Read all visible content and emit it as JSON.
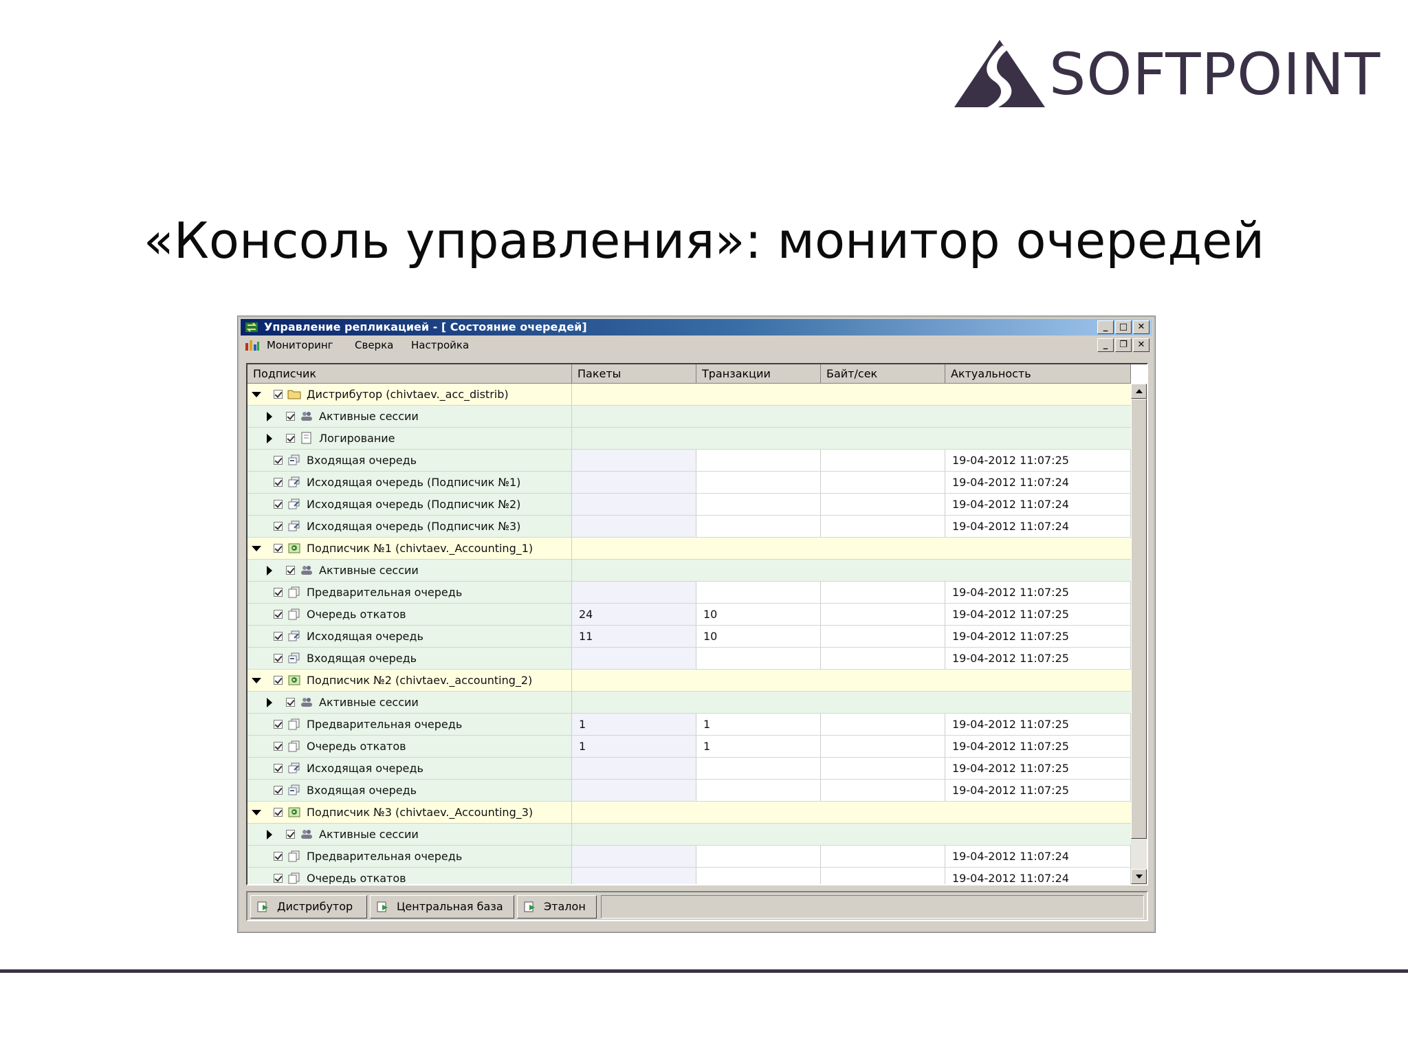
{
  "logo": {
    "text": "SOFTPOINT",
    "color": "#3b3147"
  },
  "slide_title": "«Консоль управления»: монитор очередей",
  "window": {
    "title": "Управление репликацией - [ Состояние очередей]",
    "menu": [
      "Мониторинг",
      "Сверка",
      "Настройка"
    ]
  },
  "grid": {
    "columns": [
      "Подписчик",
      "Пакеты",
      "Транзакции",
      "Байт/сек",
      "Актуальность"
    ],
    "rows": [
      {
        "level": 0,
        "expander": "down",
        "icon": "folder-icon",
        "label": "Дистрибутор  (chivtaev._acc_distrib)",
        "style": "yellow"
      },
      {
        "level": 1,
        "expander": "right",
        "icon": "users-icon",
        "label": "Активные сессии",
        "style": "green"
      },
      {
        "level": 1,
        "expander": "right",
        "icon": "log-icon",
        "label": "Логирование",
        "style": "green"
      },
      {
        "level": 0,
        "icon": "queue-in-icon",
        "label": "Входящая очередь",
        "pak": "",
        "tr": "",
        "bs": "",
        "act": "19-04-2012 11:07:25",
        "style": "data"
      },
      {
        "level": 0,
        "icon": "queue-out-icon",
        "label": "Исходящая очередь (Подписчик №1)",
        "pak": "",
        "tr": "",
        "bs": "",
        "act": "19-04-2012 11:07:24",
        "style": "data"
      },
      {
        "level": 0,
        "icon": "queue-out-icon",
        "label": "Исходящая очередь (Подписчик №2)",
        "pak": "",
        "tr": "",
        "bs": "",
        "act": "19-04-2012 11:07:24",
        "style": "data"
      },
      {
        "level": 0,
        "icon": "queue-out-icon",
        "label": "Исходящая очередь (Подписчик №3)",
        "pak": "",
        "tr": "",
        "bs": "",
        "act": "19-04-2012 11:07:24",
        "style": "data"
      },
      {
        "level": 0,
        "expander": "down",
        "icon": "subscriber-icon",
        "label": "Подписчик №1  (chivtaev._Accounting_1)",
        "style": "yellow"
      },
      {
        "level": 1,
        "expander": "right",
        "icon": "users-icon",
        "label": "Активные сессии",
        "style": "green"
      },
      {
        "level": 0,
        "icon": "queue-pre-icon",
        "label": "Предварительная очередь",
        "pak": "",
        "tr": "",
        "bs": "",
        "act": "19-04-2012 11:07:25",
        "style": "data"
      },
      {
        "level": 0,
        "icon": "queue-pre-icon",
        "label": "Очередь откатов",
        "pak": "24",
        "tr": "10",
        "bs": "",
        "act": "19-04-2012 11:07:25",
        "style": "data"
      },
      {
        "level": 0,
        "icon": "queue-out-icon",
        "label": "Исходящая очередь",
        "pak": "11",
        "tr": "10",
        "bs": "",
        "act": "19-04-2012 11:07:25",
        "style": "data"
      },
      {
        "level": 0,
        "icon": "queue-in-icon",
        "label": "Входящая очередь",
        "pak": "",
        "tr": "",
        "bs": "",
        "act": "19-04-2012 11:07:25",
        "style": "data"
      },
      {
        "level": 0,
        "expander": "down",
        "icon": "subscriber-icon",
        "label": "Подписчик №2  (chivtaev._accounting_2)",
        "style": "yellow"
      },
      {
        "level": 1,
        "expander": "right",
        "icon": "users-icon",
        "label": "Активные сессии",
        "style": "green"
      },
      {
        "level": 0,
        "icon": "queue-pre-icon",
        "label": "Предварительная очередь",
        "pak": "1",
        "tr": "1",
        "bs": "",
        "act": "19-04-2012 11:07:25",
        "style": "data"
      },
      {
        "level": 0,
        "icon": "queue-pre-icon",
        "label": "Очередь откатов",
        "pak": "1",
        "tr": "1",
        "bs": "",
        "act": "19-04-2012 11:07:25",
        "style": "data"
      },
      {
        "level": 0,
        "icon": "queue-out-icon",
        "label": "Исходящая очередь",
        "pak": "",
        "tr": "",
        "bs": "",
        "act": "19-04-2012 11:07:25",
        "style": "data"
      },
      {
        "level": 0,
        "icon": "queue-in-icon",
        "label": "Входящая очередь",
        "pak": "",
        "tr": "",
        "bs": "",
        "act": "19-04-2012 11:07:25",
        "style": "data"
      },
      {
        "level": 0,
        "expander": "down",
        "icon": "subscriber-icon",
        "label": "Подписчик №3  (chivtaev._Accounting_3)",
        "style": "yellow"
      },
      {
        "level": 1,
        "expander": "right",
        "icon": "users-icon",
        "label": "Активные сессии",
        "style": "green"
      },
      {
        "level": 0,
        "icon": "queue-pre-icon",
        "label": "Предварительная очередь",
        "pak": "",
        "tr": "",
        "bs": "",
        "act": "19-04-2012 11:07:24",
        "style": "data"
      },
      {
        "level": 0,
        "icon": "queue-pre-icon",
        "label": "Очередь откатов",
        "pak": "",
        "tr": "",
        "bs": "",
        "act": "19-04-2012 11:07:24",
        "style": "data"
      }
    ]
  },
  "tabs": [
    "Дистрибутор",
    "Центральная база",
    "Эталон"
  ]
}
